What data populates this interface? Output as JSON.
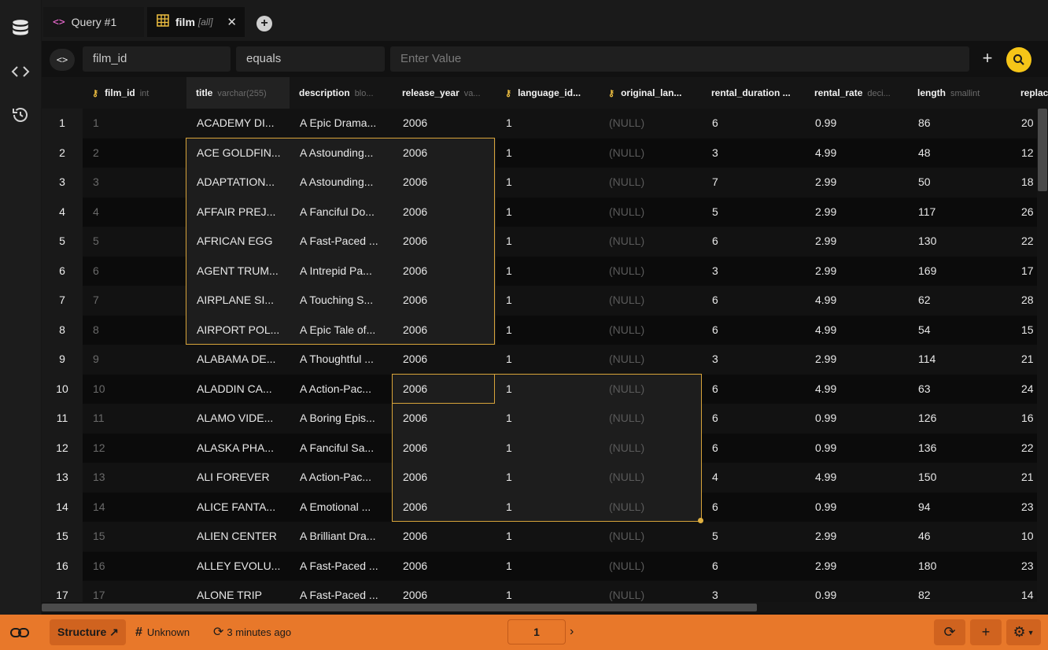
{
  "tabs": [
    {
      "icon": "code-icon",
      "label": "Query #1"
    },
    {
      "icon": "table-icon",
      "label": "film",
      "tag": "[all]"
    }
  ],
  "filter": {
    "column": "film_id",
    "operator": "equals",
    "value_placeholder": "Enter Value"
  },
  "columns": [
    {
      "name": "film_id",
      "type": "int",
      "key": true
    },
    {
      "name": "title",
      "type": "varchar(255)",
      "key": false
    },
    {
      "name": "description",
      "type": "blo...",
      "key": false
    },
    {
      "name": "release_year",
      "type": "va...",
      "key": false
    },
    {
      "name": "language_id...",
      "type": "",
      "key": true
    },
    {
      "name": "original_lan...",
      "type": "",
      "key": true
    },
    {
      "name": "rental_duration ...",
      "type": "",
      "key": false
    },
    {
      "name": "rental_rate",
      "type": "deci...",
      "key": false
    },
    {
      "name": "length",
      "type": "smallint",
      "key": false
    },
    {
      "name": "replac",
      "type": "",
      "key": false
    }
  ],
  "rows": [
    {
      "n": "1",
      "film_id": "1",
      "title": "ACADEMY DI...",
      "description": "A Epic Drama...",
      "release_year": "2006",
      "language_id": "1",
      "original_language": "(NULL)",
      "rental_duration": "6",
      "rental_rate": "0.99",
      "length": "86",
      "replace": "20"
    },
    {
      "n": "2",
      "film_id": "2",
      "title": "ACE GOLDFIN...",
      "description": "A Astounding...",
      "release_year": "2006",
      "language_id": "1",
      "original_language": "(NULL)",
      "rental_duration": "3",
      "rental_rate": "4.99",
      "length": "48",
      "replace": "12"
    },
    {
      "n": "3",
      "film_id": "3",
      "title": "ADAPTATION...",
      "description": "A Astounding...",
      "release_year": "2006",
      "language_id": "1",
      "original_language": "(NULL)",
      "rental_duration": "7",
      "rental_rate": "2.99",
      "length": "50",
      "replace": "18"
    },
    {
      "n": "4",
      "film_id": "4",
      "title": "AFFAIR PREJ...",
      "description": "A Fanciful Do...",
      "release_year": "2006",
      "language_id": "1",
      "original_language": "(NULL)",
      "rental_duration": "5",
      "rental_rate": "2.99",
      "length": "117",
      "replace": "26"
    },
    {
      "n": "5",
      "film_id": "5",
      "title": "AFRICAN EGG",
      "description": "A Fast-Paced ...",
      "release_year": "2006",
      "language_id": "1",
      "original_language": "(NULL)",
      "rental_duration": "6",
      "rental_rate": "2.99",
      "length": "130",
      "replace": "22"
    },
    {
      "n": "6",
      "film_id": "6",
      "title": "AGENT TRUM...",
      "description": "A Intrepid Pa...",
      "release_year": "2006",
      "language_id": "1",
      "original_language": "(NULL)",
      "rental_duration": "3",
      "rental_rate": "2.99",
      "length": "169",
      "replace": "17"
    },
    {
      "n": "7",
      "film_id": "7",
      "title": "AIRPLANE SI...",
      "description": "A Touching S...",
      "release_year": "2006",
      "language_id": "1",
      "original_language": "(NULL)",
      "rental_duration": "6",
      "rental_rate": "4.99",
      "length": "62",
      "replace": "28"
    },
    {
      "n": "8",
      "film_id": "8",
      "title": "AIRPORT POL...",
      "description": "A Epic Tale of...",
      "release_year": "2006",
      "language_id": "1",
      "original_language": "(NULL)",
      "rental_duration": "6",
      "rental_rate": "4.99",
      "length": "54",
      "replace": "15"
    },
    {
      "n": "9",
      "film_id": "9",
      "title": "ALABAMA DE...",
      "description": "A Thoughtful ...",
      "release_year": "2006",
      "language_id": "1",
      "original_language": "(NULL)",
      "rental_duration": "3",
      "rental_rate": "2.99",
      "length": "114",
      "replace": "21"
    },
    {
      "n": "10",
      "film_id": "10",
      "title": "ALADDIN CA...",
      "description": "A Action-Pac...",
      "release_year": "2006",
      "language_id": "1",
      "original_language": "(NULL)",
      "rental_duration": "6",
      "rental_rate": "4.99",
      "length": "63",
      "replace": "24"
    },
    {
      "n": "11",
      "film_id": "11",
      "title": "ALAMO VIDE...",
      "description": "A Boring Epis...",
      "release_year": "2006",
      "language_id": "1",
      "original_language": "(NULL)",
      "rental_duration": "6",
      "rental_rate": "0.99",
      "length": "126",
      "replace": "16"
    },
    {
      "n": "12",
      "film_id": "12",
      "title": "ALASKA PHA...",
      "description": "A Fanciful Sa...",
      "release_year": "2006",
      "language_id": "1",
      "original_language": "(NULL)",
      "rental_duration": "6",
      "rental_rate": "0.99",
      "length": "136",
      "replace": "22"
    },
    {
      "n": "13",
      "film_id": "13",
      "title": "ALI FOREVER",
      "description": "A Action-Pac...",
      "release_year": "2006",
      "language_id": "1",
      "original_language": "(NULL)",
      "rental_duration": "4",
      "rental_rate": "4.99",
      "length": "150",
      "replace": "21"
    },
    {
      "n": "14",
      "film_id": "14",
      "title": "ALICE FANTA...",
      "description": "A Emotional ...",
      "release_year": "2006",
      "language_id": "1",
      "original_language": "(NULL)",
      "rental_duration": "6",
      "rental_rate": "0.99",
      "length": "94",
      "replace": "23"
    },
    {
      "n": "15",
      "film_id": "15",
      "title": "ALIEN CENTER",
      "description": "A Brilliant Dra...",
      "release_year": "2006",
      "language_id": "1",
      "original_language": "(NULL)",
      "rental_duration": "5",
      "rental_rate": "2.99",
      "length": "46",
      "replace": "10"
    },
    {
      "n": "16",
      "film_id": "16",
      "title": "ALLEY EVOLU...",
      "description": "A Fast-Paced ...",
      "release_year": "2006",
      "language_id": "1",
      "original_language": "(NULL)",
      "rental_duration": "6",
      "rental_rate": "2.99",
      "length": "180",
      "replace": "23"
    },
    {
      "n": "17",
      "film_id": "17",
      "title": "ALONE TRIP",
      "description": "A Fast-Paced ...",
      "release_year": "2006",
      "language_id": "1",
      "original_language": "(NULL)",
      "rental_duration": "3",
      "rental_rate": "0.99",
      "length": "82",
      "replace": "14"
    }
  ],
  "status": {
    "structure_label": "Structure ↗",
    "count_label": "Unknown",
    "time_label": "3 minutes ago",
    "page": "1"
  },
  "colors": {
    "accent": "#f5c518",
    "statusbar": "#e8782a",
    "selection_border": "#d8a43a"
  }
}
